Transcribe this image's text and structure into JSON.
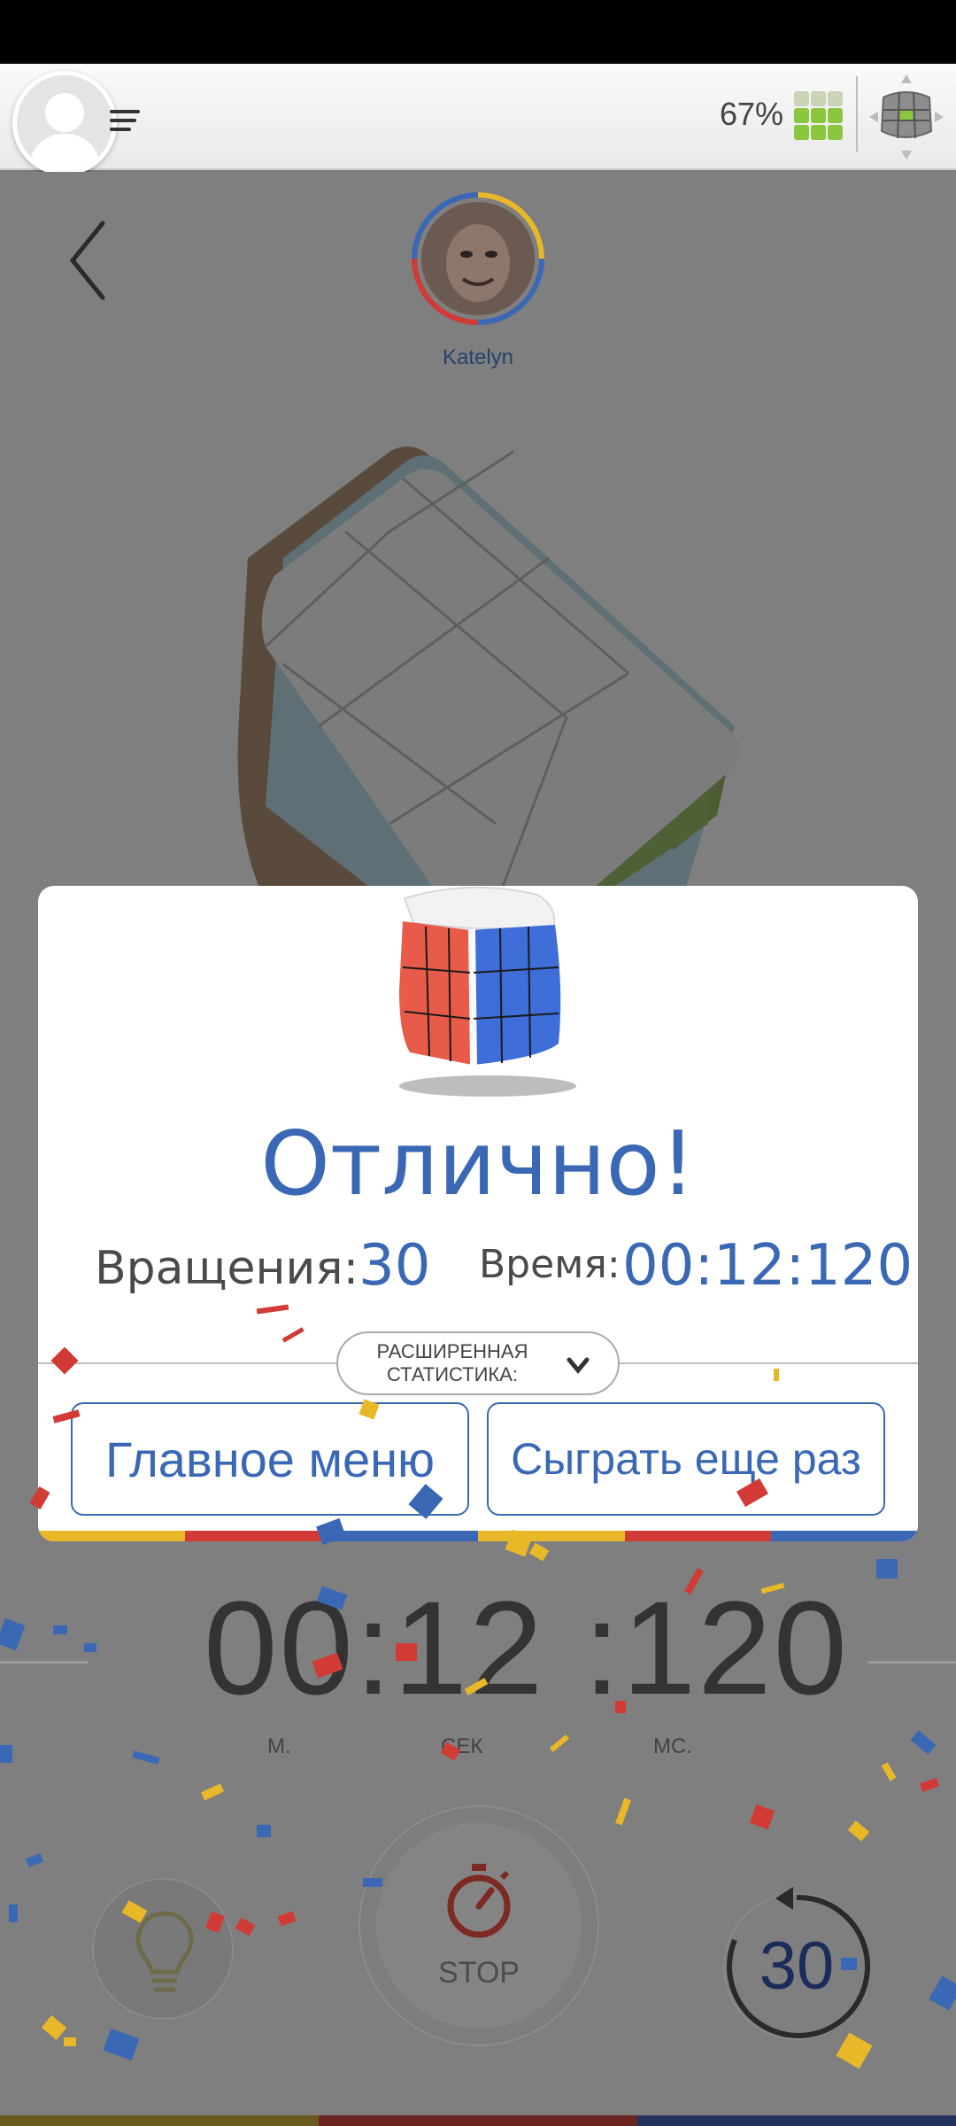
{
  "topbar": {
    "battery_text": "67%",
    "icons": [
      "avatar-icon",
      "menu-icon",
      "grid-icon",
      "cube-navigation-icon"
    ]
  },
  "player": {
    "name": "Katelyn"
  },
  "timer": {
    "digits": "00:12 :120",
    "unit_min": "М.",
    "unit_sec": "СЕК",
    "unit_ms": "МС."
  },
  "controls": {
    "stop_label": "STOP",
    "moves": "30"
  },
  "modal": {
    "title": "Отлично!",
    "rotations_label": "Вращения:",
    "rotations_value": "30",
    "time_label": "Время:",
    "time_value": "00:12:120",
    "extended_stats_line1": "РАСШИРЕННАЯ",
    "extended_stats_line2": "СТАТИСТИКА:",
    "main_menu_button": "Главное меню",
    "play_again_button": "Сыграть еще раз"
  },
  "colors": {
    "accent_blue": "#3a68b5",
    "stripe_yellow": "#e8b828",
    "stripe_red": "#d23a35",
    "stripe_blue": "#3a68b5"
  }
}
